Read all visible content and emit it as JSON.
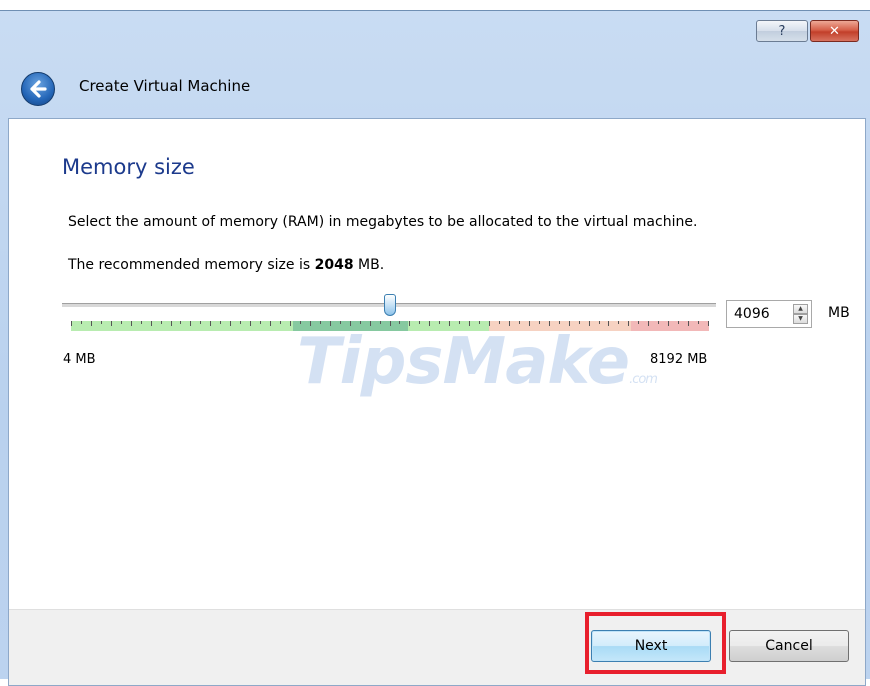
{
  "window": {
    "title": "Create Virtual Machine",
    "help_label": "?",
    "close_label": "✕"
  },
  "page": {
    "heading": "Memory size",
    "description": "Select the amount of memory (RAM) in megabytes to be allocated to the virtual machine.",
    "recommend_prefix": "The recommended memory size is ",
    "recommend_value": "2048",
    "recommend_suffix": " MB."
  },
  "memory": {
    "value": "4096",
    "unit": "MB",
    "min_label": "4 MB",
    "max_label": "8192 MB",
    "slider_fraction": 0.5
  },
  "watermark": {
    "text": "TipsMake",
    "suffix": ".com"
  },
  "buttons": {
    "next": "Next",
    "cancel": "Cancel"
  },
  "colors": {
    "scale_green": "#b8ecb0",
    "scale_green_dark": "#86c9a0",
    "scale_orange": "#f6d2c2",
    "scale_red": "#f2b8b8",
    "highlight": "#e81f2d"
  }
}
